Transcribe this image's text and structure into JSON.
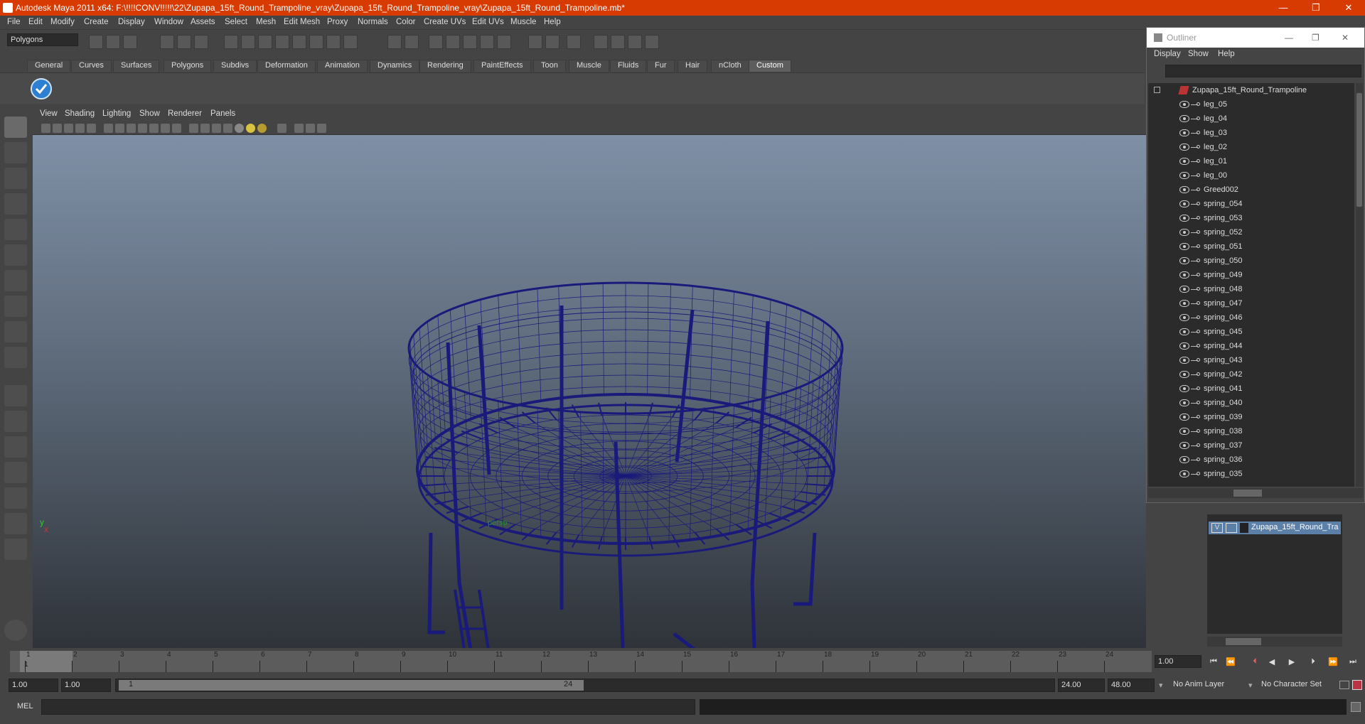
{
  "window": {
    "title": "Autodesk Maya 2011 x64: F:\\!!!!CONV!!!!!\\22\\Zupapa_15ft_Round_Trampoline_vray\\Zupapa_15ft_Round_Trampoline_vray\\Zupapa_15ft_Round_Trampoline.mb*",
    "minimize_glyph": "—",
    "maximize_glyph": "❐",
    "close_glyph": "✕",
    "accent_color": "#d83b01"
  },
  "menubar": [
    "File",
    "Edit",
    "Modify",
    "Create",
    "Display",
    "Window",
    "Assets",
    "Select",
    "Mesh",
    "Edit Mesh",
    "Proxy",
    "Normals",
    "Color",
    "Create UVs",
    "Edit UVs",
    "Muscle",
    "Help"
  ],
  "statusline": {
    "mode": "Polygons"
  },
  "shelf": {
    "tabs": [
      "General",
      "Curves",
      "Surfaces",
      "Polygons",
      "Subdivs",
      "Deformation",
      "Animation",
      "Dynamics",
      "Rendering",
      "PaintEffects",
      "Toon",
      "Muscle",
      "Fluids",
      "Fur",
      "Hair",
      "nCloth",
      "Custom"
    ],
    "active_tab": "Custom"
  },
  "viewport": {
    "menu": [
      "View",
      "Shading",
      "Lighting",
      "Show",
      "Renderer",
      "Panels"
    ],
    "camera_label": "persp",
    "axis_x": "x",
    "axis_y": "y",
    "wire_color": "#1a1a7a"
  },
  "outliner": {
    "title": "Outliner",
    "menu": [
      "Display",
      "Show",
      "Help"
    ],
    "root": "Zupapa_15ft_Round_Trampoline",
    "items": [
      "leg_05",
      "leg_04",
      "leg_03",
      "leg_02",
      "leg_01",
      "leg_00",
      "Greed002",
      "spring_054",
      "spring_053",
      "spring_052",
      "spring_051",
      "spring_050",
      "spring_049",
      "spring_048",
      "spring_047",
      "spring_046",
      "spring_045",
      "spring_044",
      "spring_043",
      "spring_042",
      "spring_041",
      "spring_040",
      "spring_039",
      "spring_038",
      "spring_037",
      "spring_036",
      "spring_035"
    ]
  },
  "layers": {
    "visible_flag": "V",
    "layer_name": "Zupapa_15ft_Round_Tra"
  },
  "timeline": {
    "ticks": [
      "1",
      "2",
      "3",
      "4",
      "5",
      "6",
      "7",
      "8",
      "9",
      "10",
      "11",
      "12",
      "13",
      "14",
      "15",
      "16",
      "17",
      "18",
      "19",
      "20",
      "21",
      "22",
      "23",
      "24"
    ],
    "current_frame_marker": "1",
    "current_time": "1.00"
  },
  "range": {
    "start_time": "1.00",
    "playback_start": "1.00",
    "slider_start": "1",
    "slider_end": "24",
    "playback_end": "24.00",
    "end_time": "48.00",
    "anim_layer": "No Anim Layer",
    "character_set": "No Character Set"
  },
  "command": {
    "label": "MEL"
  }
}
